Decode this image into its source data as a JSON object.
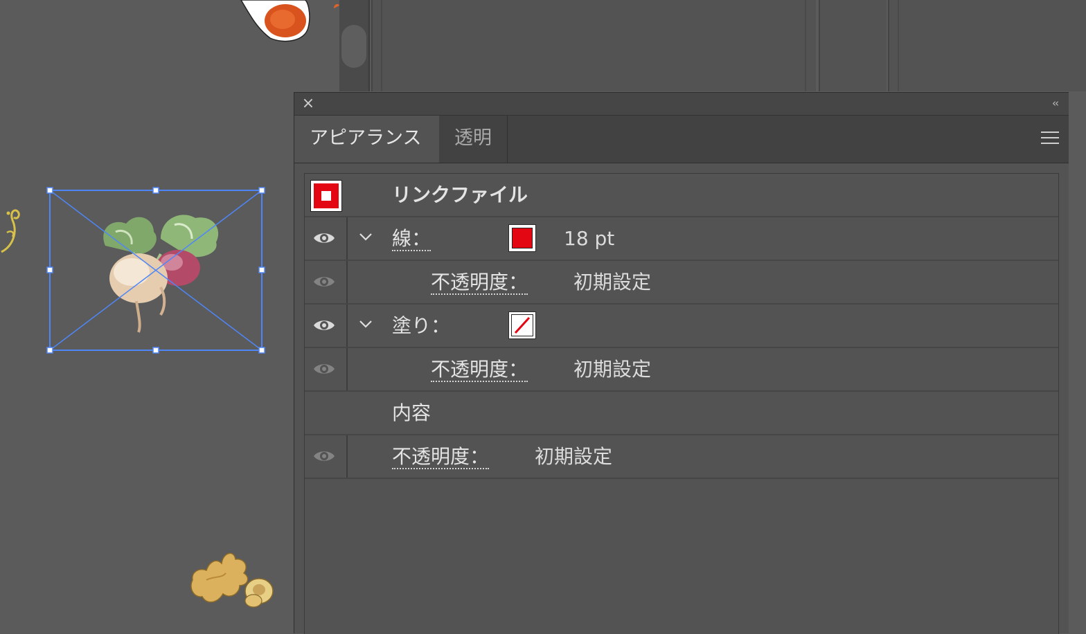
{
  "panel": {
    "tabs": [
      {
        "label": "アピアランス",
        "active": true
      },
      {
        "label": "透明",
        "active": false
      }
    ],
    "close_icon": "close-icon",
    "collapse_icon": "double-chevron-left-icon",
    "menu_icon": "hamburger-menu-icon"
  },
  "appearance": {
    "object_title": "リンクファイル",
    "stroke": {
      "label": "線：",
      "weight": "18 pt",
      "color": "#e30613",
      "opacity_label": "不透明度：",
      "opacity_value": "初期設定"
    },
    "fill": {
      "label": "塗り：",
      "color": "none",
      "opacity_label": "不透明度：",
      "opacity_value": "初期設定"
    },
    "contents_label": "内容",
    "object_opacity": {
      "label": "不透明度：",
      "value": "初期設定"
    }
  },
  "colors": {
    "accent_red": "#e30613",
    "selection_blue": "#4f86f7"
  }
}
